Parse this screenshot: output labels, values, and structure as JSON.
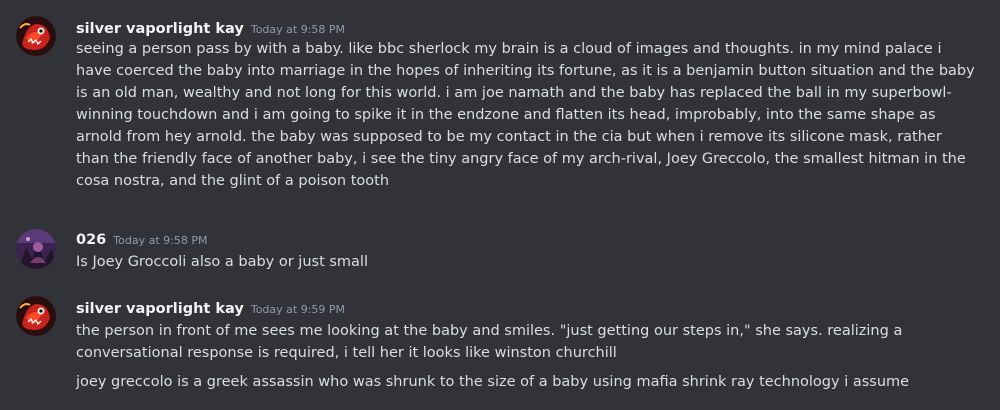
{
  "messages": [
    {
      "author": "silver vaporlight kay",
      "timestamp": "Today at 9:58 PM",
      "avatar_icon": "red-creature-avatar-icon",
      "lines": [
        "seeing a person pass by with a baby. like bbc sherlock my brain is a cloud of images and thoughts. in my mind palace i have coerced the baby into marriage in the hopes of inheriting its fortune, as it is a benjamin button situation and the baby is an old man, wealthy and not long for this world. i am joe namath and the baby has replaced the ball in my superbowl-winning touchdown and i am going to spike it in the endzone and flatten its head, improbably, into the same shape as arnold from hey arnold. the baby was supposed to be my contact in the cia but when i remove its silicone mask, rather than the friendly face of another baby, i see the tiny angry face of my arch-rival, Joey Greccolo, the smallest hitman in the cosa nostra, and the glint of a poison tooth"
      ]
    },
    {
      "author": "026",
      "timestamp": "Today at 9:58 PM",
      "avatar_icon": "purple-figure-avatar-icon",
      "lines": [
        "Is Joey Groccoli also a baby or just small"
      ]
    },
    {
      "author": "silver vaporlight kay",
      "timestamp": "Today at 9:59 PM",
      "avatar_icon": "red-creature-avatar-icon",
      "lines": [
        "the person in front of me sees me looking at the baby and smiles. \"just getting our steps in,\" she says. realizing a conversational response is required, i tell her it looks like winston churchill",
        "joey greccolo is a greek assassin who was shrunk to the size of a baby using mafia shrink ray technology i assume"
      ]
    }
  ],
  "colors": {
    "background": "#313338",
    "username": "#f2f3f5",
    "timestamp": "#949ba4",
    "message_text": "#dbdee1"
  }
}
